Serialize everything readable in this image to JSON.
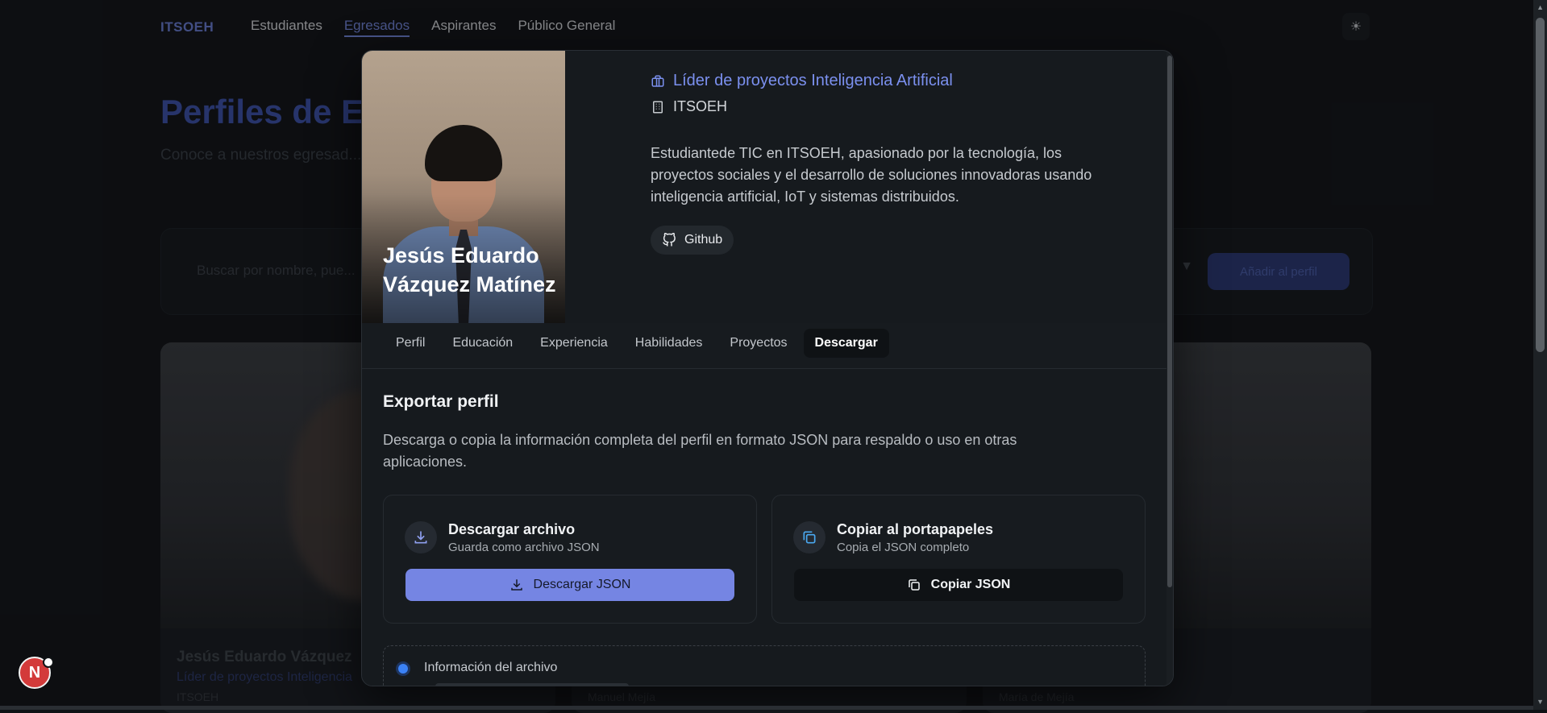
{
  "nav": {
    "logo": "ITSOEH",
    "links": [
      "Estudiantes",
      "Egresados",
      "Aspirantes",
      "Público General"
    ],
    "active_index": 1,
    "theme_icon": "sun-icon"
  },
  "background": {
    "title": "Perfiles de Eg",
    "subtitle": "Conoce a nuestros egresad... Información y Comunicació...",
    "search_placeholder": "Buscar por nombre, pue...",
    "search_button": "Añadir al perfil",
    "cards": [
      {
        "name": "Jesús Eduardo Vázquez",
        "role": "Líder de proyectos Inteligencia",
        "org": "ITSOEH"
      },
      {
        "name": "",
        "role": "",
        "org": "Manuel Mejía"
      },
      {
        "name": "",
        "role": "",
        "org": "María de Mejía"
      }
    ]
  },
  "profile": {
    "name": "Jesús Eduardo Vázquez Matínez",
    "role": "Líder de proyectos Inteligencia Artificial",
    "org": "ITSOEH",
    "bio": "Estudiantede TIC en ITSOEH, apasionado por la tecnología, los proyectos sociales y el desarrollo de soluciones innovadoras usando inteligencia artificial, IoT y sistemas distribuidos.",
    "github_label": "Github"
  },
  "tabs": [
    "Perfil",
    "Educación",
    "Experiencia",
    "Habilidades",
    "Proyectos",
    "Descargar"
  ],
  "active_tab": "Descargar",
  "export": {
    "title": "Exportar perfil",
    "description": "Descarga o copia la información completa del perfil en formato JSON para respaldo o uso en otras aplicaciones.",
    "download_card": {
      "title": "Descargar archivo",
      "subtitle": "Guarda como archivo JSON",
      "button": "Descargar JSON",
      "icon": "download-icon"
    },
    "copy_card": {
      "title": "Copiar al portapapeles",
      "subtitle": "Copia el JSON completo",
      "button": "Copiar JSON",
      "icon": "copy-icon"
    },
    "file_info_title": "Información del archivo"
  },
  "badge": {
    "letter": "N"
  },
  "colors": {
    "accent": "#7585e3",
    "link": "#7b90ef",
    "background": "#0f1215",
    "modal": "#161a1e",
    "badge": "#d33a3a"
  }
}
